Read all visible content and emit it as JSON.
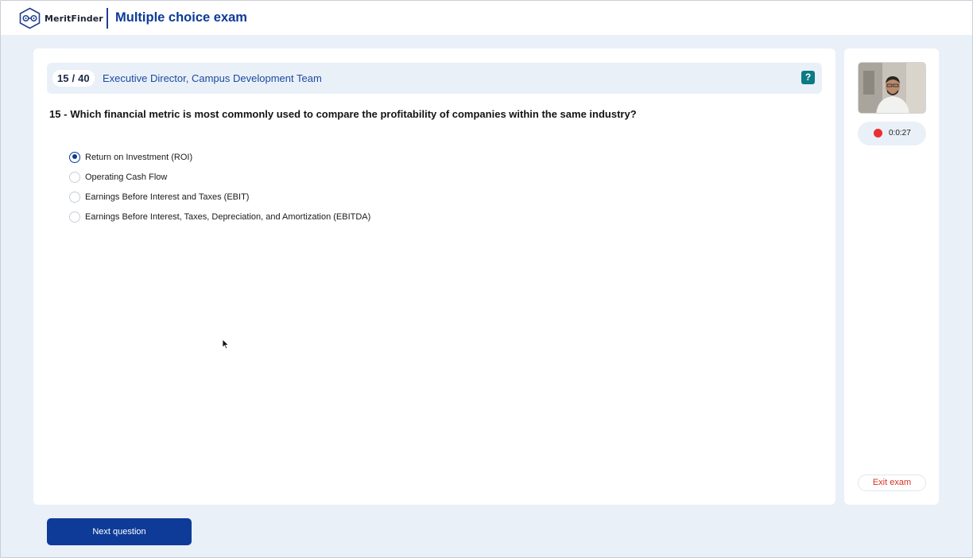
{
  "app": {
    "brand_name": "MeritFinder",
    "page_title": "Multiple choice exam"
  },
  "question_bar": {
    "current": "15",
    "separator": "/",
    "total": "40",
    "role": "Executive Director, Campus Development Team",
    "help_label": "?"
  },
  "question": {
    "number": "15 -",
    "text": "Which financial metric is most commonly used to compare the profitability of companies within the same industry?",
    "selected_index": 0,
    "options": [
      {
        "label": "Return on Investment (ROI)",
        "selected": true
      },
      {
        "label": "Operating Cash Flow",
        "selected": false
      },
      {
        "label": "Earnings Before Interest and Taxes (EBIT)",
        "selected": false
      },
      {
        "label": "Earnings Before Interest, Taxes, Depreciation, and Amortization (EBITDA)",
        "selected": false
      }
    ]
  },
  "side_panel": {
    "timer": "0:0:27",
    "exit_label": "Exit exam"
  },
  "footer": {
    "next_label": "Next question"
  },
  "icons": {
    "logo": "meritfinder-logo-icon",
    "help": "question-mark-icon",
    "recording": "record-dot-icon",
    "cursor": "mouse-pointer-icon"
  },
  "colors": {
    "primary": "#0d3b97",
    "help_button": "#0b7a84",
    "recording": "#e8312f",
    "exit_text": "#d93025",
    "background": "#eaf0f8"
  }
}
